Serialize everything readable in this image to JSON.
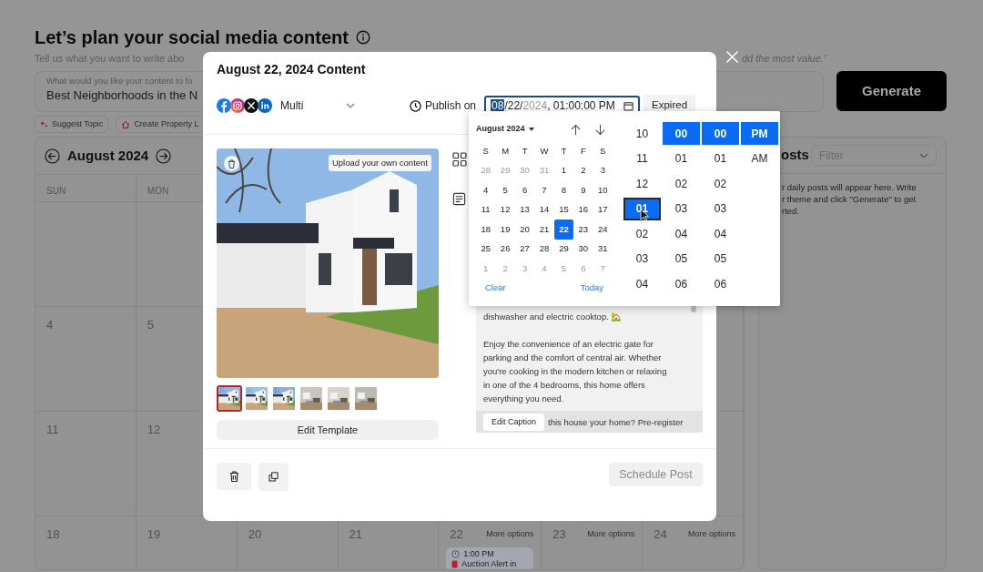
{
  "page": {
    "title": "Let’s plan your social media content",
    "subtitle_start": "Tell us what you want to write abo",
    "subtitle_end": "dd the most value.'",
    "topic_field": {
      "label": "What would you like your content to fo",
      "value": "Best Neighborhoods in the N"
    },
    "generate_button": "Generate",
    "chips": [
      {
        "kind": "suggest",
        "label": "Suggest Topic"
      },
      {
        "kind": "property",
        "label": "Create Property L"
      }
    ]
  },
  "calendar": {
    "month": "August 2024",
    "weekdays": [
      "SUN",
      "MON"
    ],
    "weeks": [
      {
        "days": [
          {
            "number": "4"
          },
          {
            "number": "5"
          }
        ]
      },
      {
        "days": [
          {
            "number": "11"
          },
          {
            "number": "12"
          }
        ]
      },
      {
        "days": [
          {
            "number": "18"
          },
          {
            "number": "19"
          },
          {
            "number": "20"
          },
          {
            "number": "21"
          },
          {
            "number": "22",
            "more": "More options",
            "events": [
              {
                "time": "1:00 PM",
                "title": "Auction Alert in"
              }
            ]
          },
          {
            "number": "23",
            "more": "More options"
          },
          {
            "number": "24",
            "more": "More options"
          }
        ]
      }
    ]
  },
  "posts_panel": {
    "heading": "osts",
    "filter_placeholder": "Filter",
    "empty_text": "r daily posts will appear here. Write\nr theme and click \"Generate\" to get\nrted."
  },
  "modal": {
    "title": "August 22, 2024 Content",
    "audience": "Multi",
    "publish_label": "Publish on",
    "datetime": [
      {
        "text": "08",
        "kind": "selected"
      },
      {
        "text": "/22/",
        "kind": "normal"
      },
      {
        "text": "2024",
        "kind": "muted"
      },
      {
        "text": ", 01:00:00 PM",
        "kind": "normal"
      }
    ],
    "status": "Expired",
    "upload_label": "Upload your own content",
    "thumbnails": [
      {
        "selected": true
      },
      {
        "selected": false
      },
      {
        "selected": false
      },
      {
        "selected": false
      },
      {
        "selected": false
      },
      {
        "selected": false
      }
    ],
    "edit_template": "Edit Template",
    "caption": {
      "first_line": "dishwasher and electric cooktop. 🏡",
      "paragraph": "Enjoy the convenience of an electric gate for parking and the comfort of central air. Whether you're cooking in the modern kitchen or relaxing in one of the 4 bedrooms, this home offers everything you need.",
      "last_line": "this house your home? Pre-register",
      "edit_button": "Edit Caption"
    },
    "schedule_button": {
      "label": "Schedule Post",
      "disabled": true
    }
  },
  "datepicker": {
    "month_label": "August 2024",
    "weekdays": [
      "S",
      "M",
      "T",
      "W",
      "T",
      "F",
      "S"
    ],
    "days": [
      {
        "label": "28",
        "in_month": false,
        "selected": false
      },
      {
        "label": "29",
        "in_month": false,
        "selected": false
      },
      {
        "label": "30",
        "in_month": false,
        "selected": false
      },
      {
        "label": "31",
        "in_month": false,
        "selected": false
      },
      {
        "label": "1",
        "in_month": true,
        "selected": false
      },
      {
        "label": "2",
        "in_month": true,
        "selected": false
      },
      {
        "label": "3",
        "in_month": true,
        "selected": false
      },
      {
        "label": "4",
        "in_month": true,
        "selected": false
      },
      {
        "label": "5",
        "in_month": true,
        "selected": false
      },
      {
        "label": "6",
        "in_month": true,
        "selected": false
      },
      {
        "label": "7",
        "in_month": true,
        "selected": false
      },
      {
        "label": "8",
        "in_month": true,
        "selected": false
      },
      {
        "label": "9",
        "in_month": true,
        "selected": false
      },
      {
        "label": "10",
        "in_month": true,
        "selected": false
      },
      {
        "label": "11",
        "in_month": true,
        "selected": false
      },
      {
        "label": "12",
        "in_month": true,
        "selected": false
      },
      {
        "label": "13",
        "in_month": true,
        "selected": false
      },
      {
        "label": "14",
        "in_month": true,
        "selected": false
      },
      {
        "label": "15",
        "in_month": true,
        "selected": false
      },
      {
        "label": "16",
        "in_month": true,
        "selected": false
      },
      {
        "label": "17",
        "in_month": true,
        "selected": false
      },
      {
        "label": "18",
        "in_month": true,
        "selected": false
      },
      {
        "label": "19",
        "in_month": true,
        "selected": false
      },
      {
        "label": "20",
        "in_month": true,
        "selected": false
      },
      {
        "label": "21",
        "in_month": true,
        "selected": false
      },
      {
        "label": "22",
        "in_month": true,
        "selected": true
      },
      {
        "label": "23",
        "in_month": true,
        "selected": false
      },
      {
        "label": "24",
        "in_month": true,
        "selected": false
      },
      {
        "label": "25",
        "in_month": true,
        "selected": false
      },
      {
        "label": "26",
        "in_month": true,
        "selected": false
      },
      {
        "label": "27",
        "in_month": true,
        "selected": false
      },
      {
        "label": "28",
        "in_month": true,
        "selected": false
      },
      {
        "label": "29",
        "in_month": true,
        "selected": false
      },
      {
        "label": "30",
        "in_month": true,
        "selected": false
      },
      {
        "label": "31",
        "in_month": true,
        "selected": false
      },
      {
        "label": "1",
        "in_month": false,
        "selected": false
      },
      {
        "label": "2",
        "in_month": false,
        "selected": false
      },
      {
        "label": "3",
        "in_month": false,
        "selected": false
      },
      {
        "label": "4",
        "in_month": false,
        "selected": false
      },
      {
        "label": "5",
        "in_month": false,
        "selected": false
      },
      {
        "label": "6",
        "in_month": false,
        "selected": false
      },
      {
        "label": "7",
        "in_month": false,
        "selected": false
      }
    ],
    "clear": "Clear",
    "today": "Today",
    "time_columns": [
      {
        "items": [
          {
            "label": "10",
            "selected": false,
            "focused": false
          },
          {
            "label": "11",
            "selected": false,
            "focused": false
          },
          {
            "label": "12",
            "selected": false,
            "focused": false
          },
          {
            "label": "01",
            "selected": true,
            "focused": true
          },
          {
            "label": "02",
            "selected": false,
            "focused": false
          },
          {
            "label": "03",
            "selected": false,
            "focused": false
          },
          {
            "label": "04",
            "selected": false,
            "focused": false
          }
        ]
      },
      {
        "items": [
          {
            "label": "00",
            "selected": true
          },
          {
            "label": "01",
            "selected": false
          },
          {
            "label": "02",
            "selected": false
          },
          {
            "label": "03",
            "selected": false
          },
          {
            "label": "04",
            "selected": false
          },
          {
            "label": "05",
            "selected": false
          },
          {
            "label": "06",
            "selected": false
          }
        ]
      },
      {
        "items": [
          {
            "label": "00",
            "selected": true
          },
          {
            "label": "01",
            "selected": false
          },
          {
            "label": "02",
            "selected": false
          },
          {
            "label": "03",
            "selected": false
          },
          {
            "label": "04",
            "selected": false
          },
          {
            "label": "05",
            "selected": false
          },
          {
            "label": "06",
            "selected": false
          }
        ]
      },
      {
        "items": [
          {
            "label": "PM",
            "selected": true
          },
          {
            "label": "AM",
            "selected": false
          }
        ]
      }
    ]
  }
}
